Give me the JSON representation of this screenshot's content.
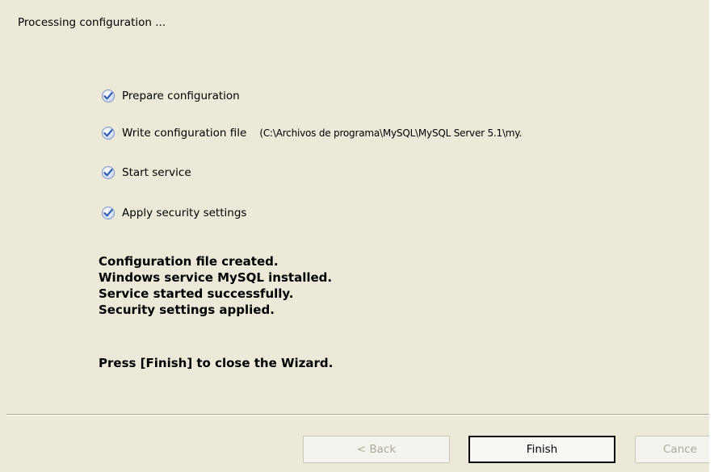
{
  "header": {
    "title": "Processing configuration ..."
  },
  "steps": [
    {
      "label": "Prepare configuration",
      "detail": "",
      "status": "done",
      "icon": "checkmark-icon"
    },
    {
      "label": "Write configuration file",
      "detail": "(C:\\Archivos de programa\\MySQL\\MySQL Server 5.1\\my.",
      "status": "done",
      "icon": "checkmark-icon"
    },
    {
      "label": "Start service",
      "detail": "",
      "status": "done",
      "icon": "checkmark-icon"
    },
    {
      "label": "Apply security settings",
      "detail": "",
      "status": "done",
      "icon": "checkmark-icon"
    }
  ],
  "messages": [
    "Configuration file created.",
    "Windows service MySQL installed.",
    "Service started successfully.",
    "Security settings applied."
  ],
  "final_message": "Press [Finish] to close the Wizard.",
  "buttons": {
    "back": "< Back",
    "finish": "Finish",
    "cancel": "Cance"
  },
  "colors": {
    "background": "#ece9d8",
    "check_blue": "#3a6fc4",
    "disabled_text": "#aca899"
  }
}
